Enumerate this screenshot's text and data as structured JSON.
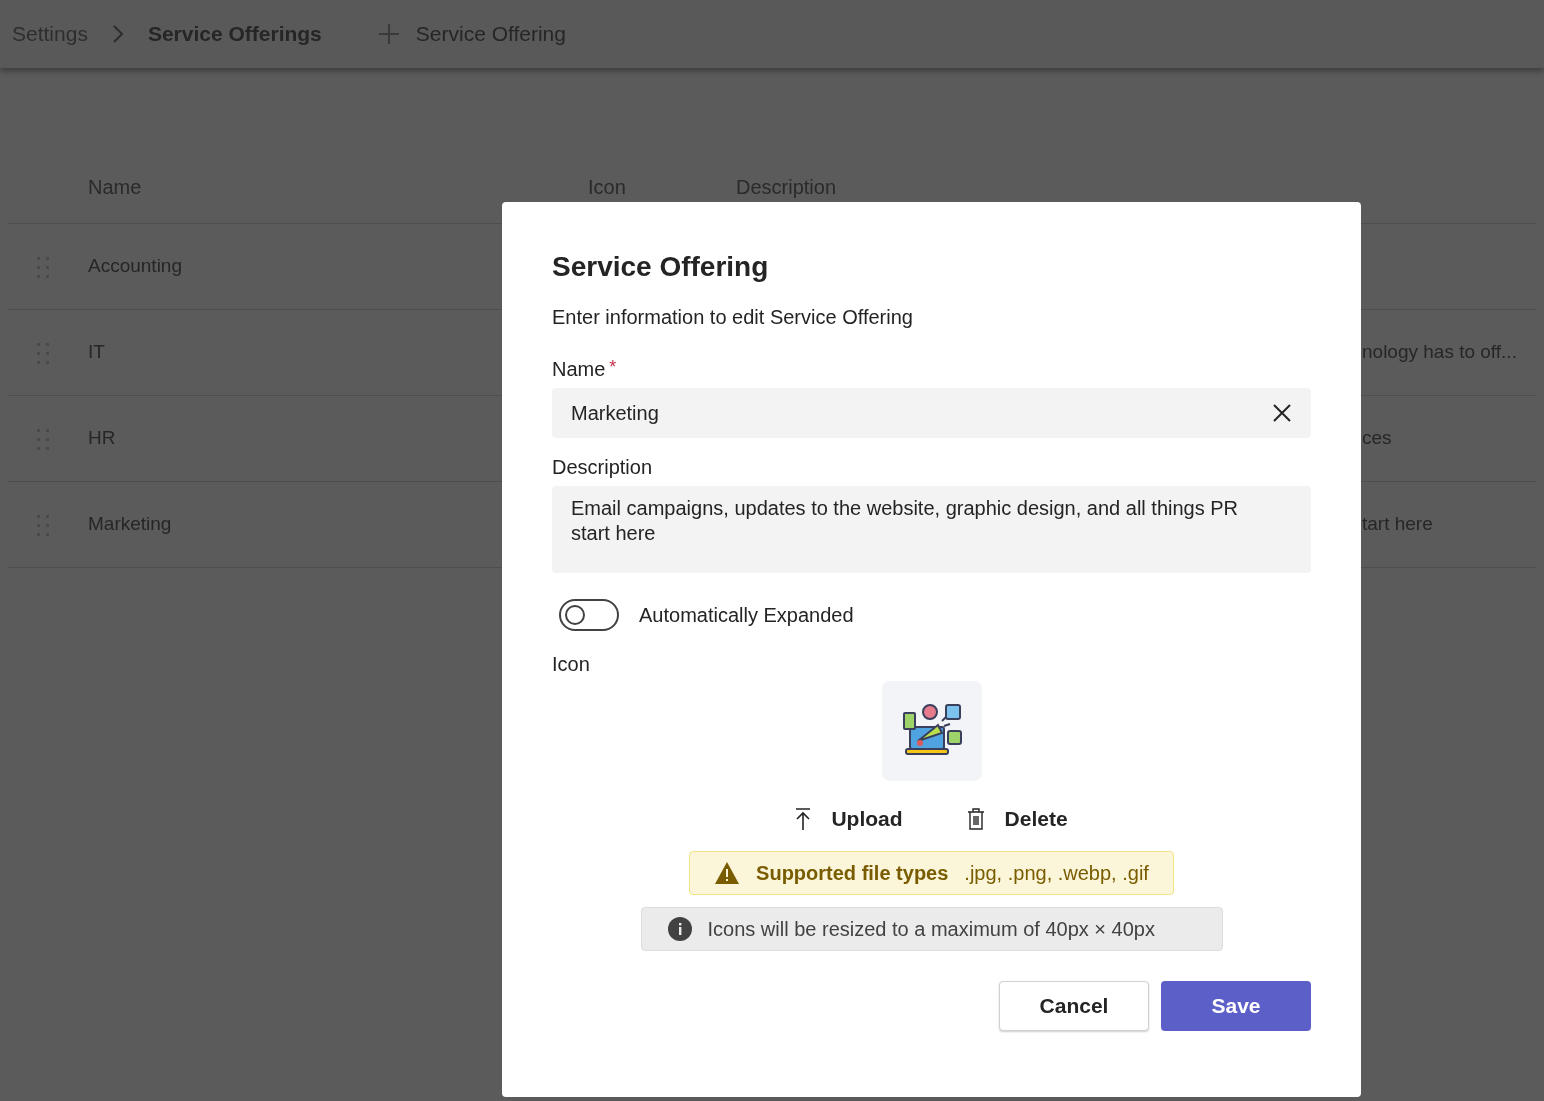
{
  "breadcrumb": [
    {
      "label": "Settings",
      "current": false
    },
    {
      "label": "Service Offerings",
      "current": true
    }
  ],
  "add_button": {
    "label": "Service Offering"
  },
  "table": {
    "columns": [
      "Name",
      "Icon",
      "Description"
    ],
    "rows": [
      {
        "name": "Accounting"
      },
      {
        "name": "IT",
        "description": "nology has to off..."
      },
      {
        "name": "HR",
        "description": "ces"
      },
      {
        "name": "Marketing",
        "description": "tart here"
      }
    ]
  },
  "dialog": {
    "title": "Service Offering",
    "subtitle": "Enter information to edit Service Offering",
    "name_label": "Name",
    "required_mark": "*",
    "name_value": "Marketing",
    "description_label": "Description",
    "description_value": "Email campaigns, updates to the website, graphic design, and all things PR start here",
    "toggle": {
      "label": "Automatically Expanded",
      "on": false
    },
    "icon_label": "Icon",
    "upload": "Upload",
    "delete": "Delete",
    "warning": {
      "title": "Supported file types",
      "text": ".jpg, .png, .webp, .gif"
    },
    "info": "Icons will be resized to a maximum of 40px × 40px",
    "buttons": {
      "cancel": "Cancel",
      "save": "Save"
    }
  }
}
